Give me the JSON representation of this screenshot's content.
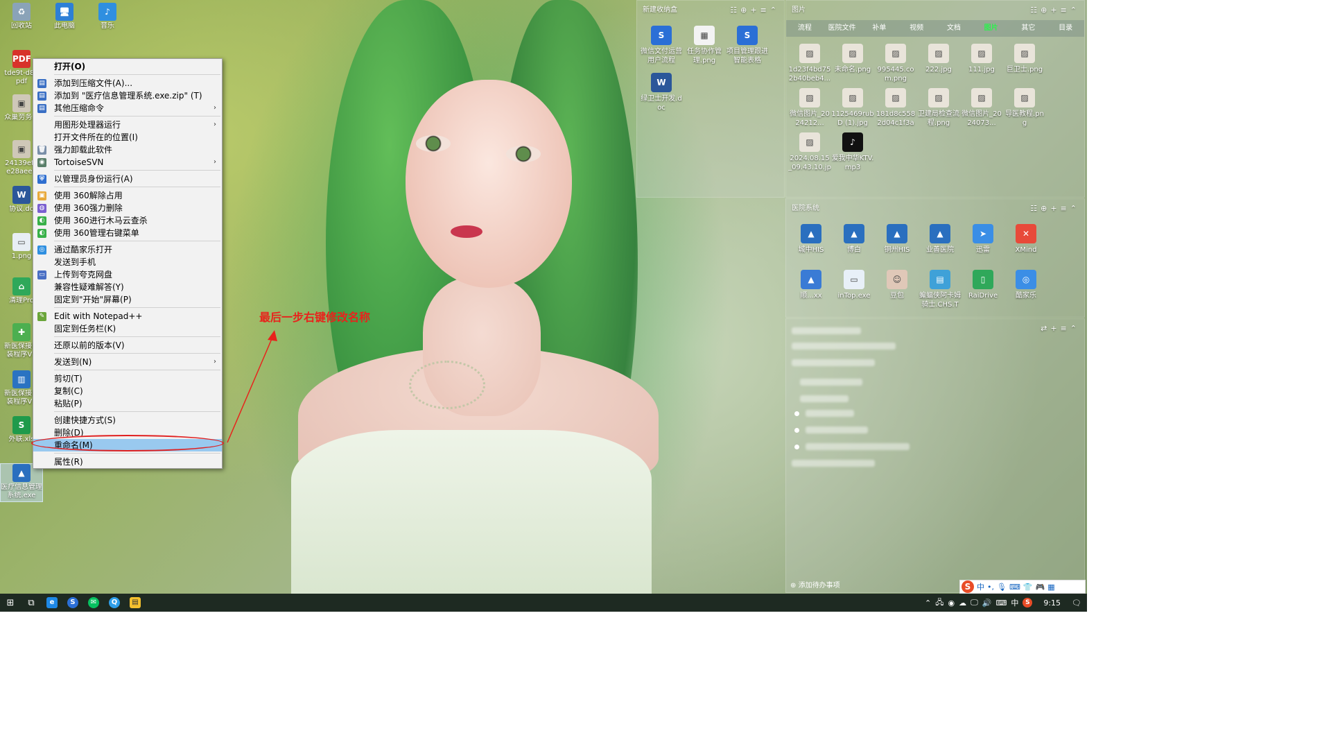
{
  "desktop": {
    "icons": [
      {
        "label": "回收站",
        "icon": "recycle-bin-icon"
      },
      {
        "label": "此电脑",
        "icon": "this-pc-icon"
      },
      {
        "label": "音乐",
        "icon": "music-note-icon"
      },
      {
        "label": "tde9t-d82",
        "label2": "pdf",
        "icon": "pdf-file-icon"
      },
      {
        "label": "众巢劳务.p",
        "icon": "image-file-icon"
      },
      {
        "label": "24139efb",
        "label2": "e28aee9",
        "icon": "image-file-icon"
      },
      {
        "label": "协议.do",
        "icon": "word-doc-icon"
      },
      {
        "label": "1.png",
        "icon": "png-file-icon"
      },
      {
        "label": "清理Pro",
        "icon": "cleaner-app-icon"
      },
      {
        "label": "新医保接口",
        "label2": "装程序V1",
        "icon": "medical-insurance-app-icon"
      },
      {
        "label": "新医保接口",
        "label2": "装程序V1",
        "icon": "installer-icon"
      },
      {
        "label": "外联.xls",
        "icon": "excel-file-icon"
      },
      {
        "label": "医疗信息管理",
        "label2": "系统.exe",
        "icon": "his-app-icon"
      }
    ]
  },
  "context_menu": {
    "items": [
      {
        "label": "打开(O)",
        "bold": true
      },
      "sep",
      {
        "label": "添加到压缩文件(A)...",
        "icon": "archive-icon"
      },
      {
        "label": "添加到 \"医疗信息管理系统.exe.zip\" (T)",
        "icon": "archive-icon"
      },
      {
        "label": "其他压缩命令",
        "icon": "archive-icon",
        "submenu": true
      },
      "sep",
      {
        "label": "用图形处理器运行",
        "submenu": true
      },
      {
        "label": "打开文件所在的位置(I)"
      },
      {
        "label": "强力卸载此软件",
        "icon": "uninstall-icon"
      },
      {
        "label": "TortoiseSVN",
        "icon": "tortoise-svn-icon",
        "submenu": true
      },
      "sep",
      {
        "label": "以管理员身份运行(A)",
        "icon": "uac-shield-icon"
      },
      "sep",
      {
        "label": "使用 360解除占用",
        "icon": "folder-unlock-icon"
      },
      {
        "label": "使用 360强力删除",
        "icon": "shred-icon"
      },
      {
        "label": "使用 360进行木马云查杀",
        "icon": "360-scan-icon"
      },
      {
        "label": "使用 360管理右键菜单",
        "icon": "360-scan-icon"
      },
      "sep",
      {
        "label": "通过酷家乐打开",
        "icon": "kujiale-icon"
      },
      {
        "label": "发送到手机"
      },
      {
        "label": "上传到夸克网盘",
        "icon": "quark-drive-icon"
      },
      {
        "label": "兼容性疑难解答(Y)"
      },
      {
        "label": "固定到\"开始\"屏幕(P)"
      },
      "sep",
      {
        "label": "Edit with Notepad++",
        "icon": "notepad-plus-plus-icon"
      },
      {
        "label": "固定到任务栏(K)"
      },
      "sep",
      {
        "label": "还原以前的版本(V)"
      },
      "sep",
      {
        "label": "发送到(N)",
        "submenu": true
      },
      "sep",
      {
        "label": "剪切(T)"
      },
      {
        "label": "复制(C)"
      },
      {
        "label": "粘贴(P)"
      },
      "sep",
      {
        "label": "创建快捷方式(S)"
      },
      {
        "label": "删除(D)"
      },
      {
        "label": "重命名(M)",
        "highlight": true
      },
      "sep",
      {
        "label": "属性(R)"
      }
    ]
  },
  "annotation": {
    "text": "最后一步右键修改名称",
    "color": "#e8231c"
  },
  "fences": {
    "new_box": {
      "title": "新建收纳盒",
      "items": [
        {
          "label": "微信文付运营用户流程",
          "icon": "sogou-s-icon"
        },
        {
          "label": "任务协作管理.png",
          "icon": "qr-code-icon"
        },
        {
          "label": "项目管理跟进智能表格",
          "icon": "sogou-s-icon"
        },
        {
          "label": "绿卫士开发.doc",
          "icon": "word-doc-icon"
        }
      ]
    },
    "pictures": {
      "title": "图片",
      "tabs": [
        "流程",
        "医院文件",
        "补单",
        "视频",
        "文档",
        "图片",
        "其它",
        "目录"
      ],
      "active_tab": "图片",
      "items": [
        {
          "label": "1d23f4bd752b40beb4...",
          "icon": "image-thumb-icon"
        },
        {
          "label": "未命名.png",
          "icon": "image-thumb-icon"
        },
        {
          "label": "995445.com.png",
          "icon": "image-thumb-icon"
        },
        {
          "label": "222.jpg",
          "icon": "image-thumb-icon"
        },
        {
          "label": "111.jpg",
          "icon": "image-thumb-icon"
        },
        {
          "label": "巨卫士.png",
          "icon": "image-thumb-icon"
        },
        {
          "label": "微信图片_2024212...",
          "icon": "image-thumb-icon"
        },
        {
          "label": "1125469rubD (1).jpg",
          "icon": "image-thumb-icon"
        },
        {
          "label": "181d8c5582d04c1f3ad...",
          "icon": "image-thumb-icon"
        },
        {
          "label": "卫建局检查流程.png",
          "icon": "image-thumb-icon"
        },
        {
          "label": "微信图片_2024073...",
          "icon": "image-thumb-icon"
        },
        {
          "label": "导医教程.png",
          "icon": "image-thumb-icon"
        },
        {
          "label": "2024.08.15_09.43.10.jpg",
          "icon": "image-thumb-icon"
        },
        {
          "label": "爱我中华KTV.mp3",
          "icon": "tiktok-icon"
        }
      ]
    },
    "medical": {
      "title": "医院系统",
      "items": [
        {
          "label": "城中HIS",
          "icon": "his-app-icon"
        },
        {
          "label": "博白",
          "icon": "his-app-icon"
        },
        {
          "label": "铜州HIS",
          "icon": "his-app-icon"
        },
        {
          "label": "业善医院",
          "icon": "his-app-icon"
        },
        {
          "label": "迅雷",
          "icon": "xunlei-icon"
        },
        {
          "label": "XMind",
          "icon": "xmind-icon"
        },
        {
          "label": "顺...xx",
          "icon": "feishu-icon"
        },
        {
          "label": "inTop.exe",
          "icon": "intop-icon"
        },
        {
          "label": "豆包",
          "icon": "doubao-icon"
        },
        {
          "label": "蝙蝠侠阿卡姆骑士.CHS.Ti...",
          "icon": "game-folder-icon"
        },
        {
          "label": "RaiDrive",
          "icon": "raidrive-icon"
        },
        {
          "label": "酷家乐",
          "icon": "kujiale-icon"
        }
      ]
    },
    "todo": {
      "add_label": "添加待办事项"
    }
  },
  "ime": {
    "logo": "S",
    "mode": "中"
  },
  "taskbar": {
    "time": "9:15",
    "lang": "中",
    "apps": [
      "windows-start-icon",
      "task-view-icon",
      "browser-icon",
      "sogou-s-icon",
      "wechat-icon",
      "search-app-icon",
      "file-explorer-icon"
    ]
  }
}
